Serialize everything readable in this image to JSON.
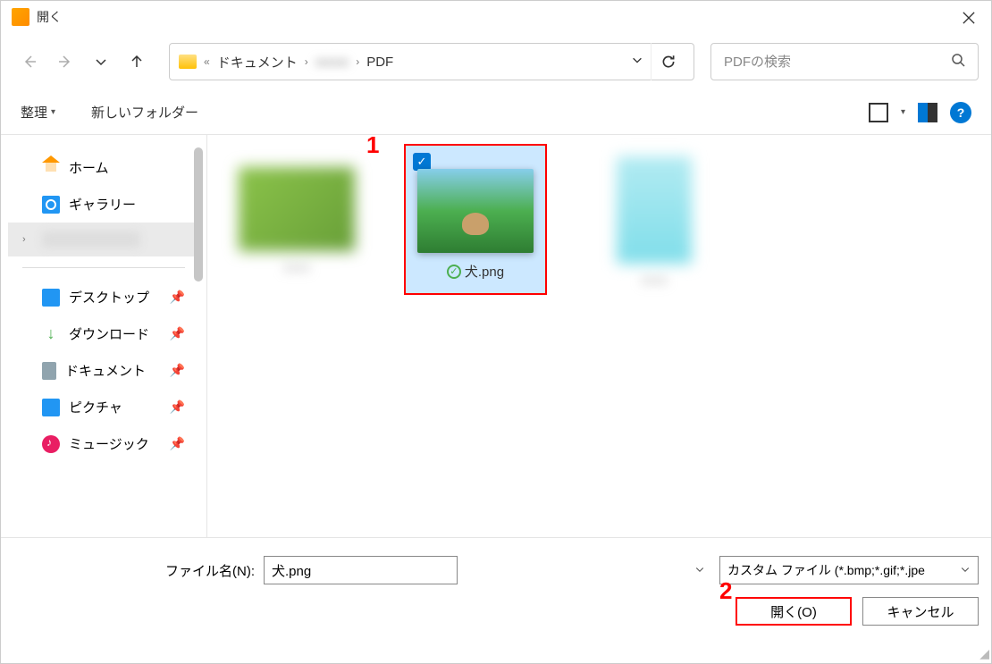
{
  "title": "開く",
  "breadcrumb": {
    "parts": [
      "ドキュメント",
      "PDF"
    ],
    "hidden_part": "..."
  },
  "search": {
    "placeholder": "PDFの検索"
  },
  "toolbar2": {
    "organize": "整理",
    "newfolder": "新しいフォルダー"
  },
  "sidebar": {
    "home": "ホーム",
    "gallery": "ギャラリー",
    "desktop": "デスクトップ",
    "downloads": "ダウンロード",
    "documents": "ドキュメント",
    "pictures": "ピクチャ",
    "music": "ミュージック"
  },
  "files": {
    "selected": {
      "name": "犬.png"
    }
  },
  "bottom": {
    "filename_label": "ファイル名(N):",
    "filename_value": "犬.png",
    "filetype": "カスタム ファイル (*.bmp;*.gif;*.jpe",
    "open": "開く(O)",
    "cancel": "キャンセル"
  },
  "annotations": {
    "a1": "1",
    "a2": "2"
  }
}
